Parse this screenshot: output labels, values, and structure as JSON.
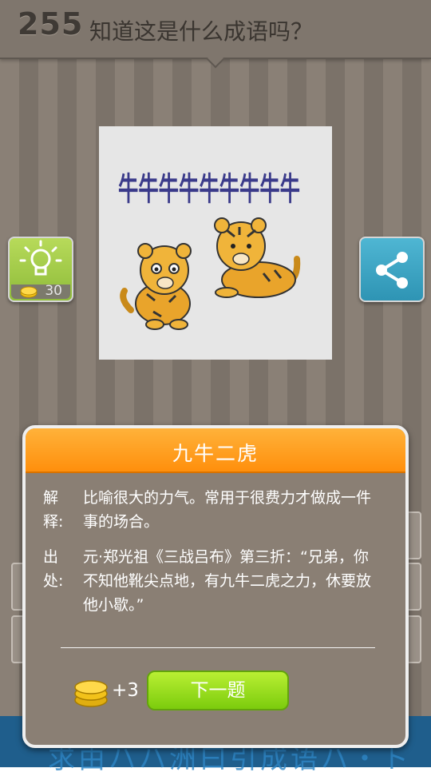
{
  "header": {
    "level": "255",
    "question": "知道这是什么成语吗？"
  },
  "puzzle": {
    "glyphs": "牛牛牛牛牛牛牛牛牛",
    "glyph_color": "#3a3a8a"
  },
  "hint": {
    "icon": "lightbulb-icon",
    "cost": "30"
  },
  "share": {
    "icon": "share-icon"
  },
  "bottom_banner": {
    "text": "求由ハハ洲曰引成语ハ・ト"
  },
  "modal": {
    "title": "九牛二虎",
    "meaning_label": "解释:",
    "meaning_text": "比喻很大的力气。常用于很费力才做成一件事的场合。",
    "source_label": "出处:",
    "source_text": "元·郑光祖《三战吕布》第三折：“兄弟，你不知他靴尖点地，有九牛二虎之力，休要放他小歇。”",
    "reward": "+3",
    "next_label": "下一题"
  },
  "colors": {
    "header_accent": "#ff9a1a",
    "next_button": "#9ee020"
  }
}
